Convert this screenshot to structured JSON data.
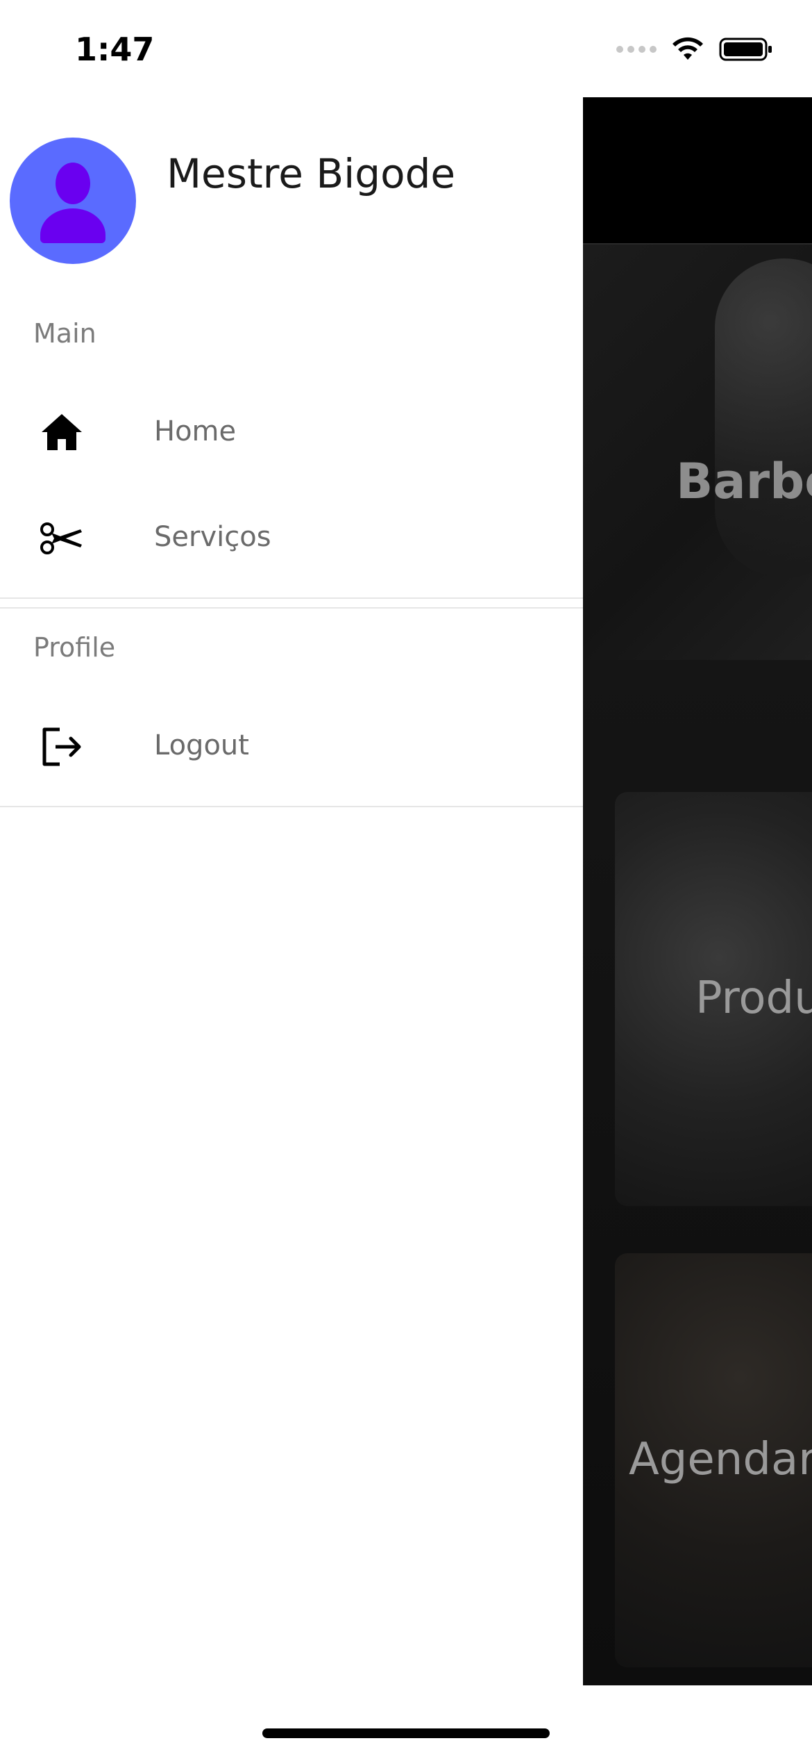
{
  "status_bar": {
    "time": "1:47"
  },
  "drawer": {
    "profile": {
      "name": "Mestre Bigode"
    },
    "sections": {
      "main": {
        "label": "Main",
        "items": [
          {
            "label": "Home",
            "icon": "home-icon"
          },
          {
            "label": "Serviços",
            "icon": "scissors-icon"
          }
        ]
      },
      "profile": {
        "label": "Profile",
        "items": [
          {
            "label": "Logout",
            "icon": "logout-icon"
          }
        ]
      }
    }
  },
  "background_app": {
    "banner_text": "Barbe",
    "cards": [
      {
        "label": "Produ"
      },
      {
        "label": "Agendar"
      }
    ]
  },
  "colors": {
    "avatar_bg": "#5a6bff",
    "avatar_figure": "#6a00f0",
    "label_gray": "#6a6a6a",
    "section_gray": "#7b7b7b"
  }
}
